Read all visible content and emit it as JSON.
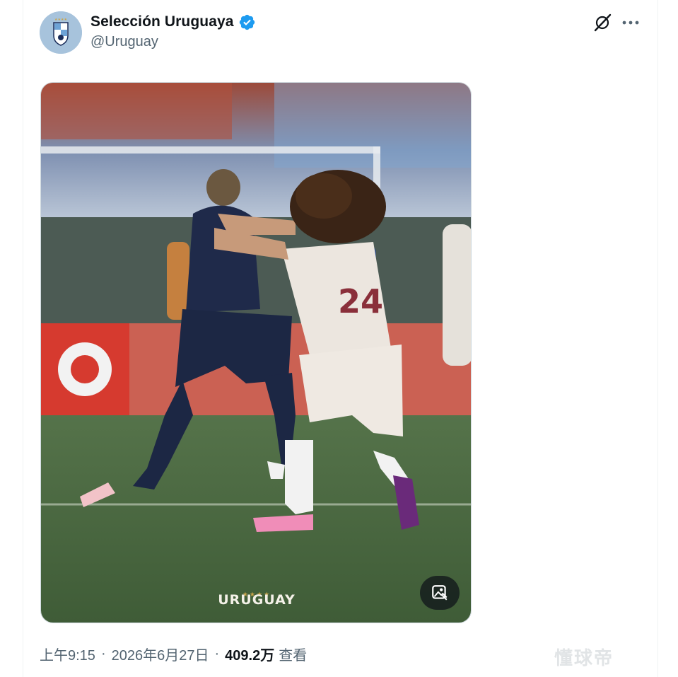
{
  "account": {
    "display_name": "Selección Uruguaya",
    "handle": "@Uruguay",
    "verified_icon": "verified-badge-icon",
    "avatar_icon": "uruguay-crest-icon"
  },
  "actions": {
    "grok_icon": "grok-icon",
    "more_icon": "more-horizontal-icon"
  },
  "media": {
    "stars": "★★★★",
    "brand_mark": "URUGUAY",
    "tag_icon": "media-tag-icon"
  },
  "meta": {
    "time": "上午9:15",
    "separator": "·",
    "date": "2026年6月27日",
    "views_count": "409.2万",
    "views_label": "查看"
  },
  "watermark": "懂球帝",
  "colors": {
    "verified_blue": "#1d9bf0",
    "secondary_text": "#536471",
    "primary_text": "#0f1419",
    "pitch_green": "#4a6a3f"
  }
}
